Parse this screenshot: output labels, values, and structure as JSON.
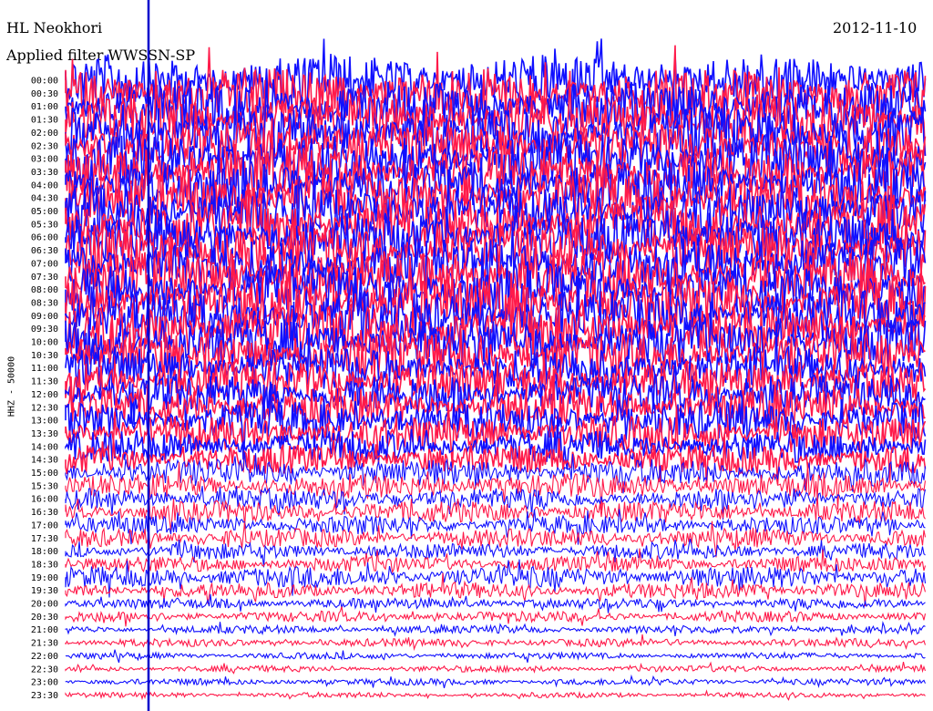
{
  "header": {
    "station": "HL Neokhori",
    "date": "2012-11-10",
    "filter": "Applied filter WWSSN-SP"
  },
  "channel_label": "HHZ - 50000",
  "colors": {
    "trace_a": "#1010ff",
    "trace_b": "#ff1a4a",
    "text": "#000000",
    "marker": "#0000cc"
  },
  "chart_data": {
    "type": "line",
    "title": "HL Neokhori",
    "subtitle": "Applied filter WWSSN-SP",
    "date": "2012-11-10",
    "ylabel": "HHZ - 50000",
    "xlabel": "",
    "rows": [
      {
        "label": "00:00",
        "color": "blue",
        "amplitude": 0.95
      },
      {
        "label": "00:30",
        "color": "red",
        "amplitude": 0.95
      },
      {
        "label": "01:00",
        "color": "blue",
        "amplitude": 0.95
      },
      {
        "label": "01:30",
        "color": "red",
        "amplitude": 0.95
      },
      {
        "label": "02:00",
        "color": "blue",
        "amplitude": 0.95
      },
      {
        "label": "02:30",
        "color": "red",
        "amplitude": 0.95
      },
      {
        "label": "03:00",
        "color": "blue",
        "amplitude": 0.95
      },
      {
        "label": "03:30",
        "color": "red",
        "amplitude": 0.95
      },
      {
        "label": "04:00",
        "color": "blue",
        "amplitude": 0.95
      },
      {
        "label": "04:30",
        "color": "red",
        "amplitude": 0.95
      },
      {
        "label": "05:00",
        "color": "blue",
        "amplitude": 0.95
      },
      {
        "label": "05:30",
        "color": "red",
        "amplitude": 0.95
      },
      {
        "label": "06:00",
        "color": "blue",
        "amplitude": 0.95
      },
      {
        "label": "06:30",
        "color": "red",
        "amplitude": 0.95
      },
      {
        "label": "07:00",
        "color": "blue",
        "amplitude": 0.95
      },
      {
        "label": "07:30",
        "color": "red",
        "amplitude": 0.95
      },
      {
        "label": "08:00",
        "color": "blue",
        "amplitude": 0.95
      },
      {
        "label": "08:30",
        "color": "red",
        "amplitude": 0.95
      },
      {
        "label": "09:00",
        "color": "blue",
        "amplitude": 0.95
      },
      {
        "label": "09:30",
        "color": "red",
        "amplitude": 0.95
      },
      {
        "label": "10:00",
        "color": "blue",
        "amplitude": 0.9
      },
      {
        "label": "10:30",
        "color": "red",
        "amplitude": 0.85
      },
      {
        "label": "11:00",
        "color": "blue",
        "amplitude": 0.8
      },
      {
        "label": "11:30",
        "color": "red",
        "amplitude": 0.75
      },
      {
        "label": "12:00",
        "color": "blue",
        "amplitude": 0.75
      },
      {
        "label": "12:30",
        "color": "red",
        "amplitude": 0.7
      },
      {
        "label": "13:00",
        "color": "blue",
        "amplitude": 0.7
      },
      {
        "label": "13:30",
        "color": "red",
        "amplitude": 0.65
      },
      {
        "label": "14:00",
        "color": "blue",
        "amplitude": 0.6
      },
      {
        "label": "14:30",
        "color": "red",
        "amplitude": 0.55
      },
      {
        "label": "15:00",
        "color": "blue",
        "amplitude": 0.5
      },
      {
        "label": "15:30",
        "color": "red",
        "amplitude": 0.45
      },
      {
        "label": "16:00",
        "color": "blue",
        "amplitude": 0.4
      },
      {
        "label": "16:30",
        "color": "red",
        "amplitude": 0.4
      },
      {
        "label": "17:00",
        "color": "blue",
        "amplitude": 0.35
      },
      {
        "label": "17:30",
        "color": "red",
        "amplitude": 0.35
      },
      {
        "label": "18:00",
        "color": "blue",
        "amplitude": 0.3
      },
      {
        "label": "18:30",
        "color": "red",
        "amplitude": 0.3
      },
      {
        "label": "19:00",
        "color": "blue",
        "amplitude": 0.4
      },
      {
        "label": "19:30",
        "color": "red",
        "amplitude": 0.3
      },
      {
        "label": "20:00",
        "color": "blue",
        "amplitude": 0.2
      },
      {
        "label": "20:30",
        "color": "red",
        "amplitude": 0.2
      },
      {
        "label": "21:00",
        "color": "blue",
        "amplitude": 0.15
      },
      {
        "label": "21:30",
        "color": "red",
        "amplitude": 0.15
      },
      {
        "label": "22:00",
        "color": "blue",
        "amplitude": 0.12
      },
      {
        "label": "22:30",
        "color": "red",
        "amplitude": 0.12
      },
      {
        "label": "23:00",
        "color": "blue",
        "amplitude": 0.12
      },
      {
        "label": "23:30",
        "color": "red",
        "amplitude": 0.1
      }
    ],
    "grid": false,
    "legend": "none"
  }
}
